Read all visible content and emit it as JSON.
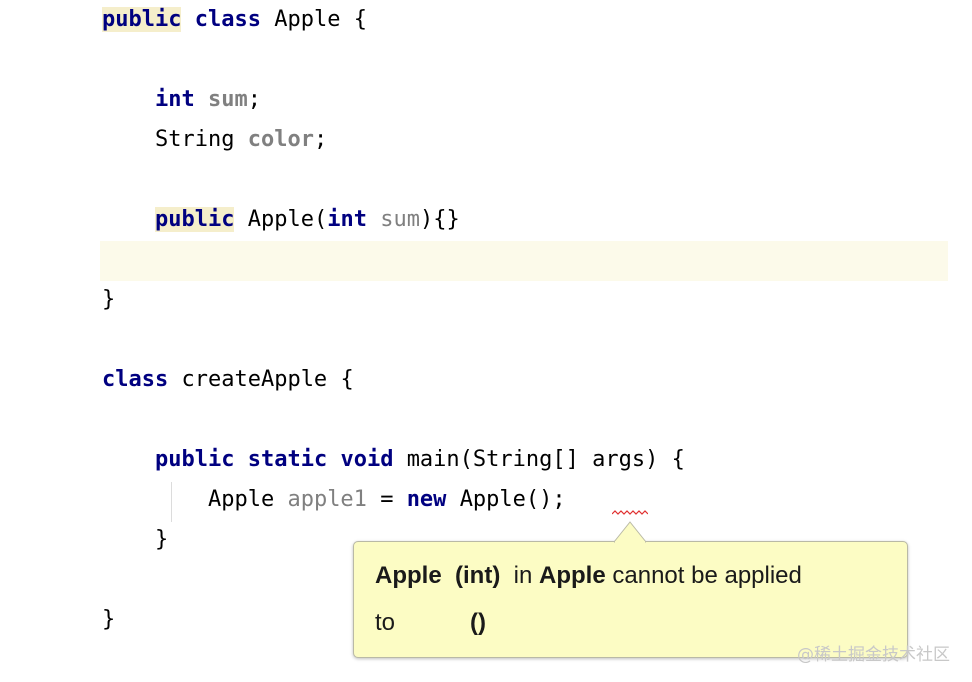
{
  "code": {
    "l1": {
      "kw1": "public",
      "kw2": "class",
      "name": "Apple",
      "brace": "{"
    },
    "l2": {
      "type": "int",
      "field": "sum",
      "semi": ";"
    },
    "l3": {
      "type": "String",
      "field": "color",
      "semi": ";"
    },
    "l4": {
      "kw": "public",
      "ctor": "Apple(",
      "ptype": "int",
      "pname": "sum",
      "tail": "){}"
    },
    "l5": {
      "brace": "}"
    },
    "l6": {
      "kw": "class",
      "name": "createApple",
      "brace": "{"
    },
    "l7": {
      "kw1": "public",
      "kw2": "static",
      "kw3": "void",
      "sig": "main(String[] args) {"
    },
    "l8": {
      "type": "Apple",
      "var": "apple1",
      "eq": "=",
      "kw": "new",
      "call": "Apple",
      "args": "()",
      "semi": ";"
    },
    "l9": {
      "brace": "}"
    },
    "l10": {
      "brace": "}"
    }
  },
  "tooltip": {
    "name": "Apple",
    "params": "(int)",
    "in": "in",
    "owner": "Apple",
    "msg": "cannot be applied",
    "to": "to",
    "args": "()"
  },
  "watermark": "@稀土掘金技术社区",
  "colors": {
    "keyword": "#000080",
    "field": "#808080",
    "tooltip_bg": "#fcfcc4",
    "error": "#e03030"
  }
}
